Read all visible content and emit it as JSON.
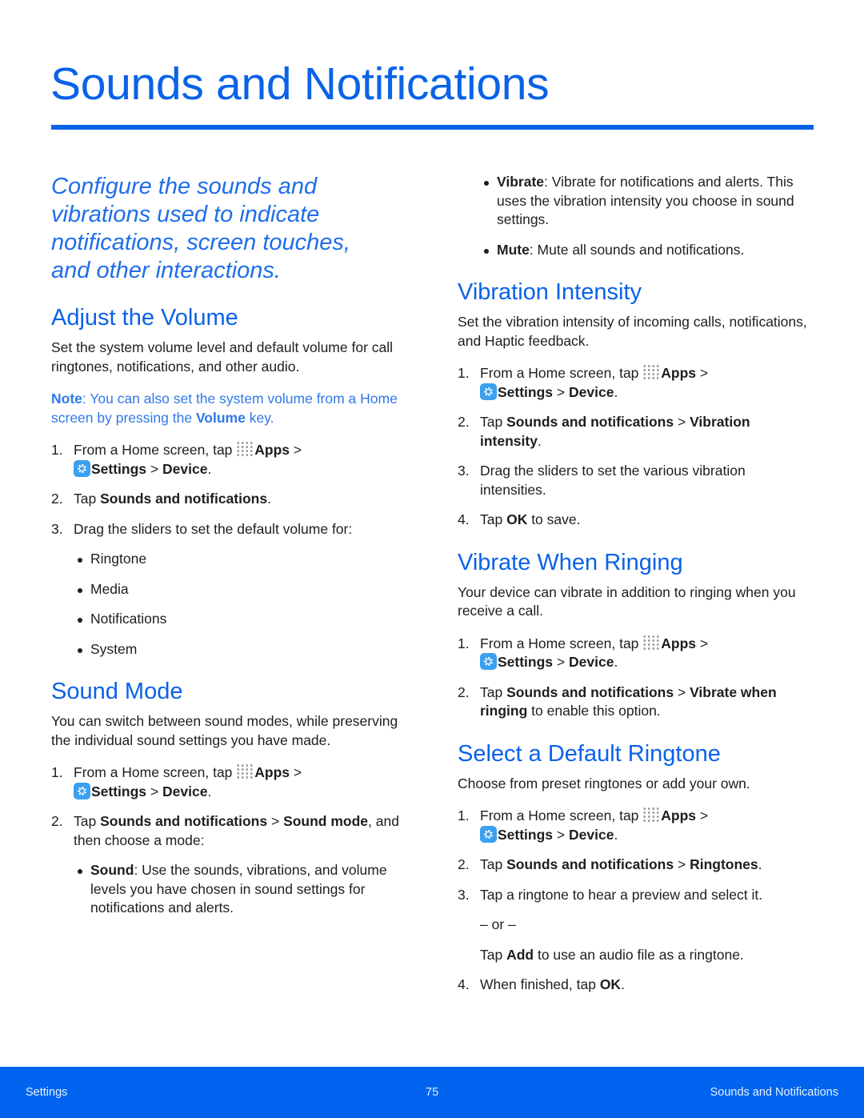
{
  "title": "Sounds and Notifications",
  "colors": {
    "accent": "#0a62e8",
    "footer": "#0064f0",
    "settings_icon": "#3aa0f0"
  },
  "left": [
    {
      "type": "intro",
      "text": "Configure the sounds and vibrations used to indicate notifications, screen touches, and other interactions."
    },
    {
      "type": "h2",
      "text": "Adjust the Volume"
    },
    {
      "type": "p",
      "segs": [
        {
          "t": "Set the system volume level and default volume for call ringtones, notifications, and other audio."
        }
      ]
    },
    {
      "type": "note",
      "segs": [
        {
          "t": "Note",
          "b": 1
        },
        {
          "t": ": You can also set the system volume from a Home screen by pressing the "
        },
        {
          "t": "Volume",
          "b": 1
        },
        {
          "t": " key."
        }
      ]
    },
    {
      "type": "ol",
      "items": [
        {
          "n": "1.",
          "segs": [
            {
              "t": "From a Home screen, tap "
            },
            {
              "i": "apps-grid-icon"
            },
            {
              "t": "Apps",
              "b": 1
            },
            {
              "t": " > "
            },
            {
              "br": 1
            },
            {
              "i": "settings-icon"
            },
            {
              "t": "Settings",
              "b": 1
            },
            {
              "t": "  > "
            },
            {
              "t": "Device",
              "b": 1
            },
            {
              "t": "."
            }
          ]
        },
        {
          "n": "2.",
          "segs": [
            {
              "t": "Tap "
            },
            {
              "t": "Sounds and notifications",
              "b": 1
            },
            {
              "t": "."
            }
          ]
        },
        {
          "n": "3.",
          "segs": [
            {
              "t": "Drag the sliders to set the default volume for:"
            }
          ],
          "bullets": [
            [
              {
                "t": "Ringtone"
              }
            ],
            [
              {
                "t": "Media"
              }
            ],
            [
              {
                "t": "Notifications"
              }
            ],
            [
              {
                "t": "System"
              }
            ]
          ]
        }
      ]
    },
    {
      "type": "h2",
      "text": "Sound Mode"
    },
    {
      "type": "p",
      "segs": [
        {
          "t": "You can switch between sound modes, while preserving the individual sound settings you have made."
        }
      ]
    },
    {
      "type": "ol",
      "items": [
        {
          "n": "1.",
          "segs": [
            {
              "t": "From a Home screen, tap "
            },
            {
              "i": "apps-grid-icon"
            },
            {
              "t": "Apps",
              "b": 1
            },
            {
              "t": " > "
            },
            {
              "br": 1
            },
            {
              "i": "settings-icon"
            },
            {
              "t": "Settings",
              "b": 1
            },
            {
              "t": "  > "
            },
            {
              "t": "Device",
              "b": 1
            },
            {
              "t": "."
            }
          ]
        },
        {
          "n": "2.",
          "segs": [
            {
              "t": "Tap "
            },
            {
              "t": "Sounds and notifications",
              "b": 1
            },
            {
              "t": " > "
            },
            {
              "t": "Sound mode",
              "b": 1
            },
            {
              "t": ", and then choose a mode:"
            }
          ],
          "bullets": [
            [
              {
                "t": "Sound",
                "b": 1
              },
              {
                "t": ": Use the sounds, vibrations, and volume levels you have chosen in sound settings for notifications and alerts."
              }
            ]
          ]
        }
      ]
    }
  ],
  "right": [
    {
      "type": "ul",
      "bullets": [
        [
          {
            "t": "Vibrate",
            "b": 1
          },
          {
            "t": ": Vibrate for notifications and alerts. This uses the vibration intensity you choose in sound settings."
          }
        ],
        [
          {
            "t": "Mute",
            "b": 1
          },
          {
            "t": ": Mute all sounds and notifications."
          }
        ]
      ]
    },
    {
      "type": "h2",
      "text": "Vibration Intensity"
    },
    {
      "type": "p",
      "segs": [
        {
          "t": "Set the vibration intensity of incoming calls, notifications, and Haptic feedback."
        }
      ]
    },
    {
      "type": "ol",
      "items": [
        {
          "n": "1.",
          "segs": [
            {
              "t": "From a Home screen, tap "
            },
            {
              "i": "apps-grid-icon"
            },
            {
              "t": "Apps",
              "b": 1
            },
            {
              "t": " > "
            },
            {
              "br": 1
            },
            {
              "i": "settings-icon"
            },
            {
              "t": "Settings",
              "b": 1
            },
            {
              "t": "  > "
            },
            {
              "t": "Device",
              "b": 1
            },
            {
              "t": "."
            }
          ]
        },
        {
          "n": "2.",
          "segs": [
            {
              "t": "Tap "
            },
            {
              "t": "Sounds and notifications",
              "b": 1
            },
            {
              "t": " > "
            },
            {
              "t": "Vibration intensity",
              "b": 1
            },
            {
              "t": "."
            }
          ]
        },
        {
          "n": "3.",
          "segs": [
            {
              "t": "Drag the sliders to set the various vibration intensities."
            }
          ]
        },
        {
          "n": "4.",
          "segs": [
            {
              "t": "Tap "
            },
            {
              "t": "OK",
              "b": 1
            },
            {
              "t": " to save."
            }
          ]
        }
      ]
    },
    {
      "type": "h2",
      "text": "Vibrate When Ringing"
    },
    {
      "type": "p",
      "segs": [
        {
          "t": "Your device can vibrate in addition to ringing when you receive a call."
        }
      ]
    },
    {
      "type": "ol",
      "items": [
        {
          "n": "1.",
          "segs": [
            {
              "t": "From a Home screen, tap "
            },
            {
              "i": "apps-grid-icon"
            },
            {
              "t": "Apps",
              "b": 1
            },
            {
              "t": " > "
            },
            {
              "br": 1
            },
            {
              "i": "settings-icon"
            },
            {
              "t": "Settings",
              "b": 1
            },
            {
              "t": "  > "
            },
            {
              "t": "Device",
              "b": 1
            },
            {
              "t": "."
            }
          ]
        },
        {
          "n": "2.",
          "segs": [
            {
              "t": "Tap "
            },
            {
              "t": "Sounds and notifications",
              "b": 1
            },
            {
              "t": " > "
            },
            {
              "t": "Vibrate when ringing",
              "b": 1
            },
            {
              "t": " to enable this option."
            }
          ]
        }
      ]
    },
    {
      "type": "h2",
      "text": "Select a Default Ringtone"
    },
    {
      "type": "p",
      "segs": [
        {
          "t": "Choose from preset ringtones or add your own."
        }
      ]
    },
    {
      "type": "ol",
      "items": [
        {
          "n": "1.",
          "segs": [
            {
              "t": "From a Home screen, tap "
            },
            {
              "i": "apps-grid-icon"
            },
            {
              "t": "Apps",
              "b": 1
            },
            {
              "t": " > "
            },
            {
              "br": 1
            },
            {
              "i": "settings-icon"
            },
            {
              "t": "Settings",
              "b": 1
            },
            {
              "t": "  > "
            },
            {
              "t": "Device",
              "b": 1
            },
            {
              "t": "."
            }
          ]
        },
        {
          "n": "2.",
          "segs": [
            {
              "t": "Tap "
            },
            {
              "t": "Sounds and notifications",
              "b": 1
            },
            {
              "t": " > "
            },
            {
              "t": "Ringtones",
              "b": 1
            },
            {
              "t": "."
            }
          ]
        },
        {
          "n": "3.",
          "segs": [
            {
              "t": "Tap a ringtone to hear a preview and select it."
            }
          ],
          "cont": [
            [
              {
                "t": "– or –"
              }
            ],
            [
              {
                "t": "Tap "
              },
              {
                "t": "Add",
                "b": 1
              },
              {
                "t": " to use an audio file as a ringtone."
              }
            ]
          ]
        },
        {
          "n": "4.",
          "segs": [
            {
              "t": "When finished, tap "
            },
            {
              "t": "OK",
              "b": 1
            },
            {
              "t": "."
            }
          ]
        }
      ]
    }
  ],
  "footer": {
    "left": "Settings",
    "page": "75",
    "right": "Sounds and Notifications"
  }
}
